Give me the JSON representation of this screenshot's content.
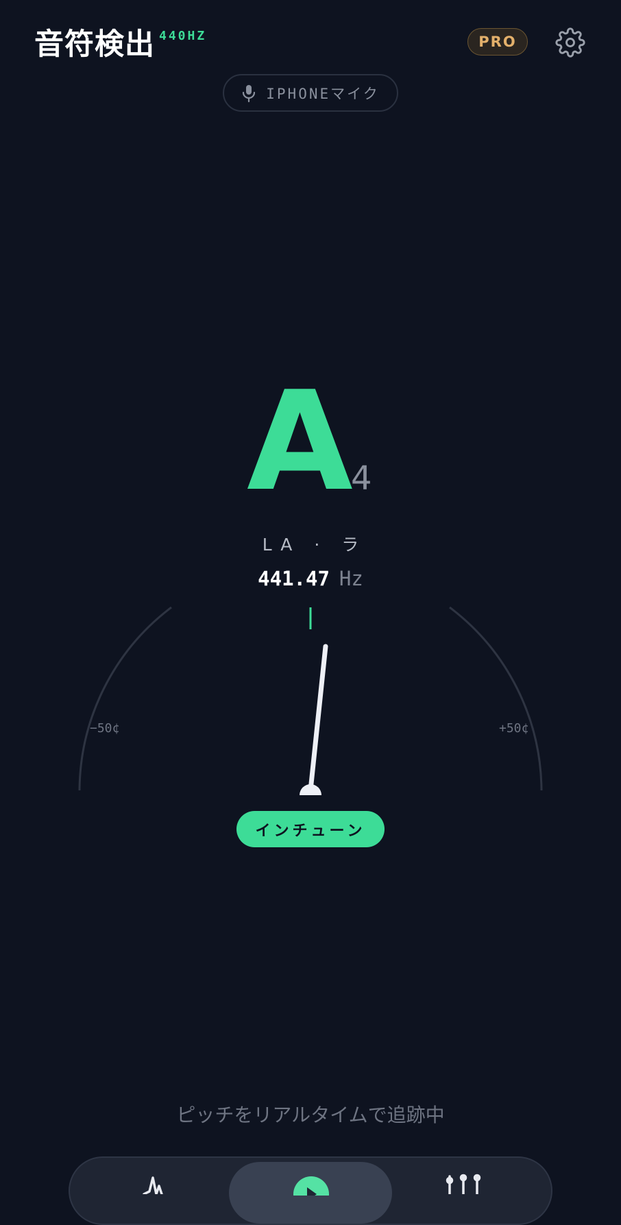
{
  "header": {
    "title": "音符検出",
    "reference": "440HZ",
    "pro_label": "PRO",
    "settings_icon": "gear-icon"
  },
  "input": {
    "label": "IPHONEマイク",
    "icon": "microphone-icon"
  },
  "tuner": {
    "note": "A",
    "octave": "4",
    "solfege": "LA · ラ",
    "frequency": "441.47",
    "unit": "Hz",
    "cents_min_label": "−50¢",
    "cents_max_label": "+50¢",
    "status": "インチューン"
  },
  "footer": {
    "text": "ピッチをリアルタイムで追跡中"
  },
  "tabs": [
    {
      "icon": "waveform-icon",
      "active": false
    },
    {
      "icon": "play-icon",
      "active": true
    },
    {
      "icon": "sliders-icon",
      "active": false
    }
  ],
  "colors": {
    "background": "#0e1320",
    "accent": "#3ddc97",
    "pro": "#e3b06b",
    "muted": "#8a909d"
  }
}
